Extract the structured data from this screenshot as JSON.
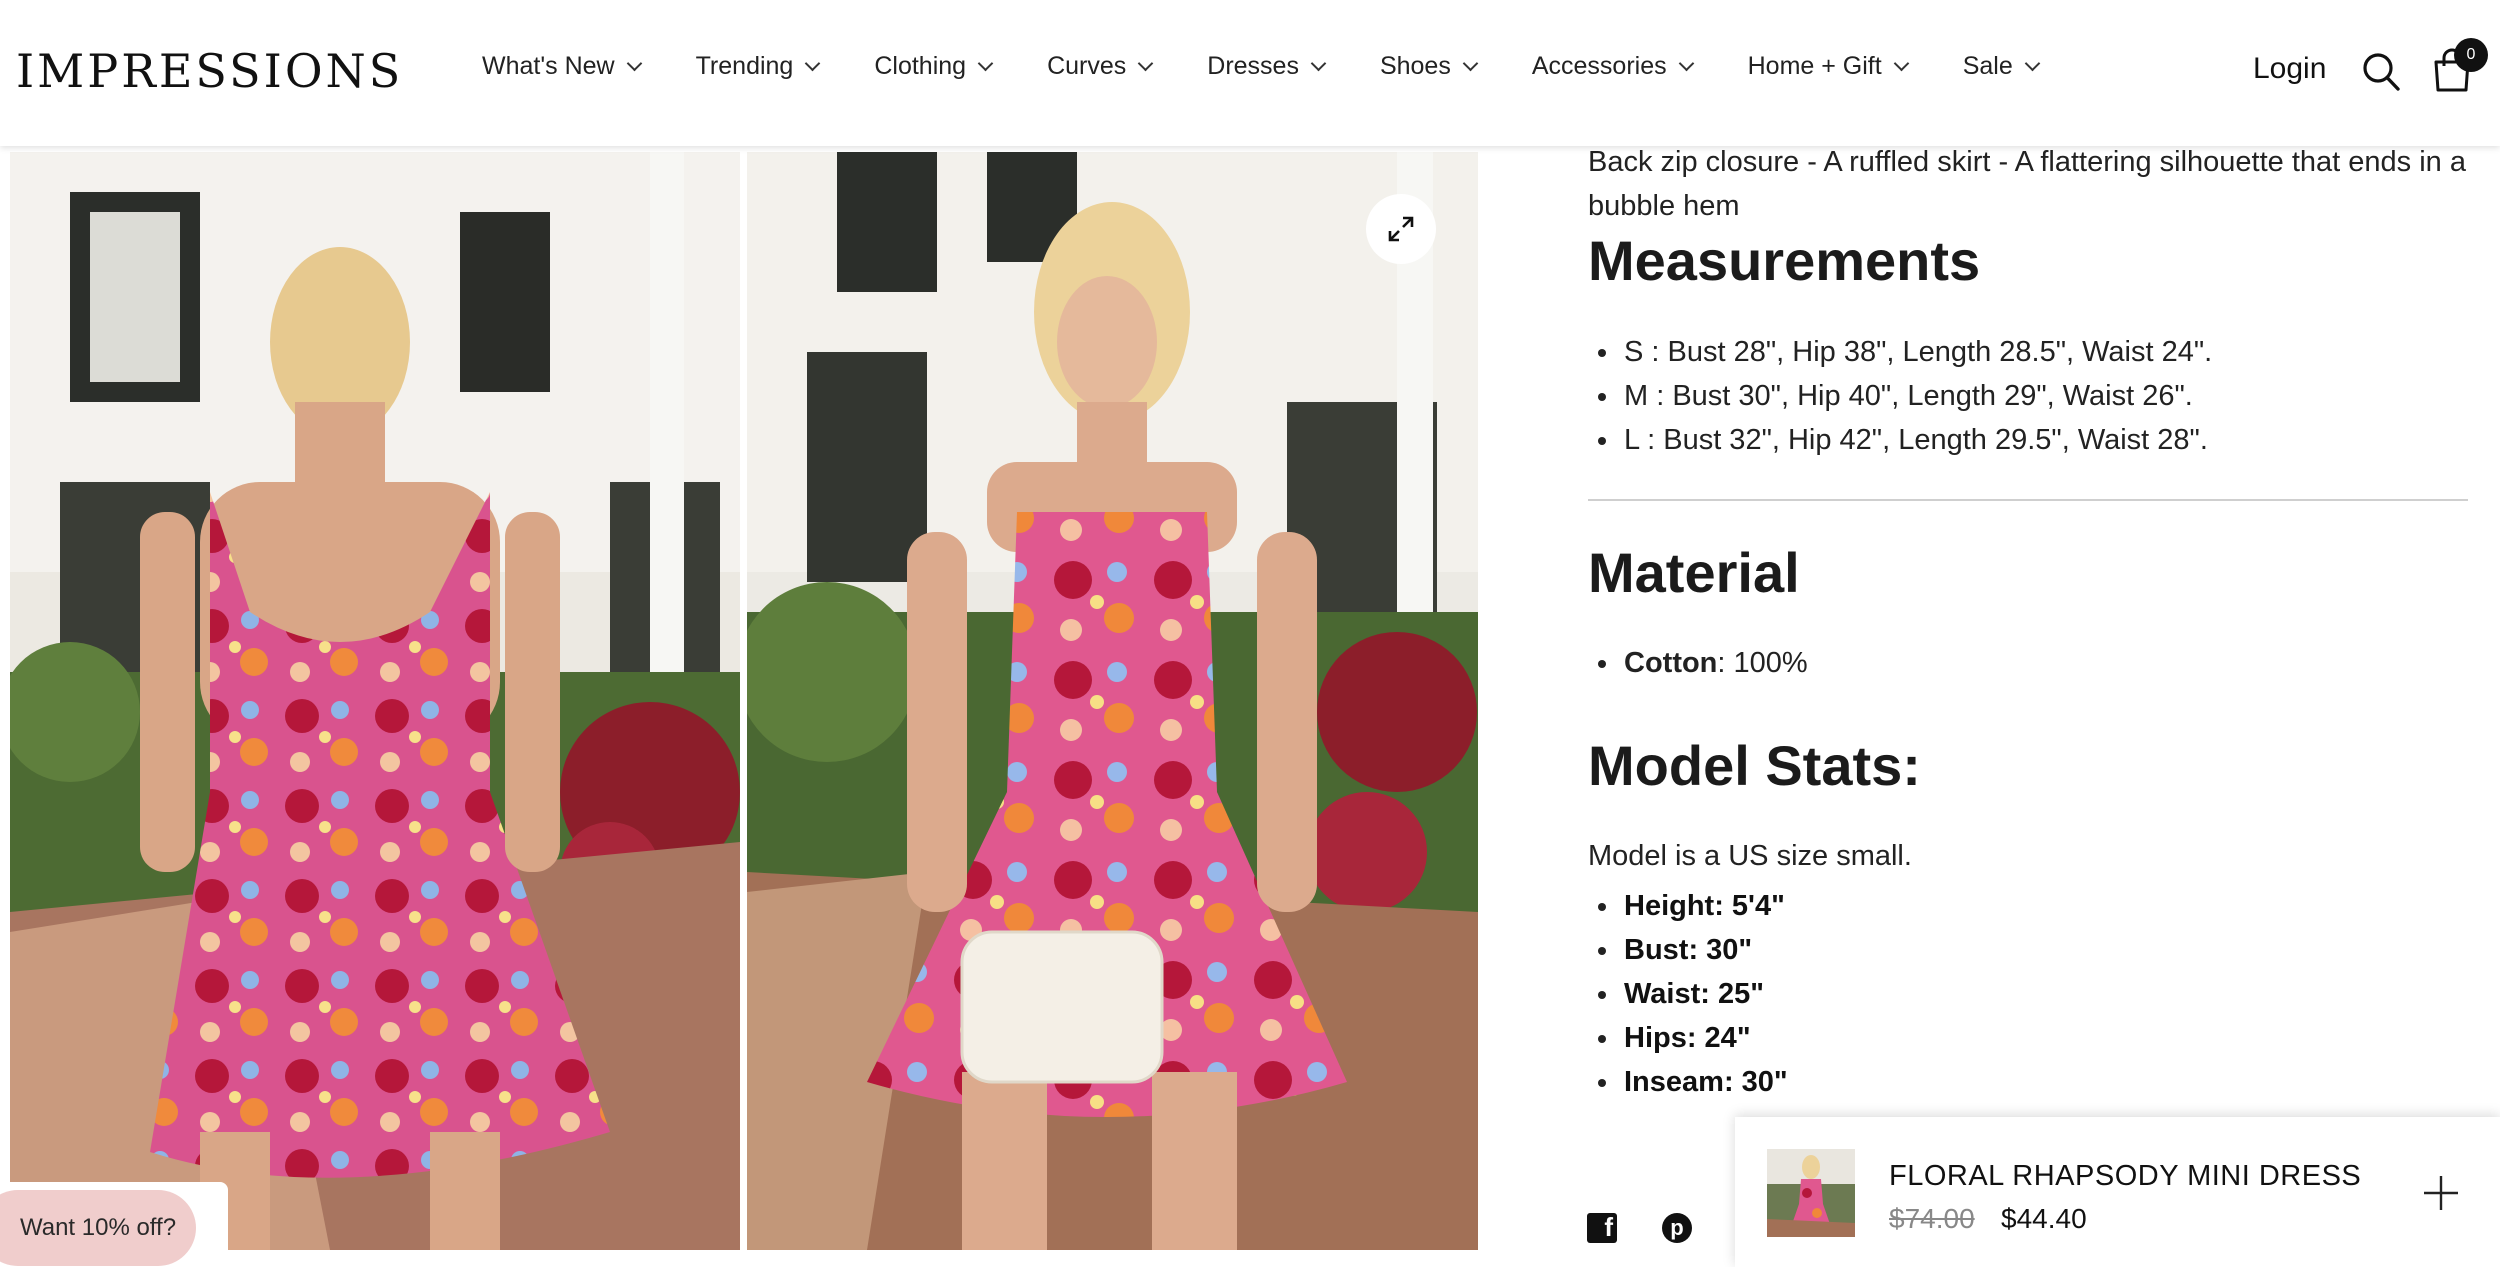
{
  "header": {
    "logo": "IMPRESSIONS",
    "nav": [
      "What's New",
      "Trending",
      "Clothing",
      "Curves",
      "Dresses",
      "Shoes",
      "Accessories",
      "Home + Gift",
      "Sale"
    ],
    "login": "Login",
    "cart_count": "0"
  },
  "details": {
    "description": "Back zip closure - A ruffled skirt - A flattering silhouette that ends in a bubble hem",
    "measurements_title": "Measurements",
    "measurements": [
      "S : Bust 28\", Hip 38\", Length 28.5\", Waist 24\".",
      "M : Bust 30\", Hip 40\", Length 29\", Waist 26\".",
      "L : Bust 32\", Hip 42\", Length 29.5\", Waist 28\"."
    ],
    "material_title": "Material",
    "material_name": "Cotton",
    "material_value": ": 100%",
    "stats_title": "Model Stats:",
    "model_note": "Model is a US size small.",
    "stats": [
      "Height: 5'4\"",
      "Bust: 30\"",
      "Waist: 25\"",
      "Hips: 24\"",
      "Inseam: 30\""
    ]
  },
  "promo": {
    "label": "Want 10% off?"
  },
  "sticky_bar": {
    "title": "FLORAL RHAPSODY MINI DRESS",
    "old_price": "$74.00",
    "new_price": "$44.40"
  },
  "colors": {
    "accent_pink": "#f0cdcc",
    "dress_pink": "#e0588f",
    "dress_red": "#b5173a"
  }
}
